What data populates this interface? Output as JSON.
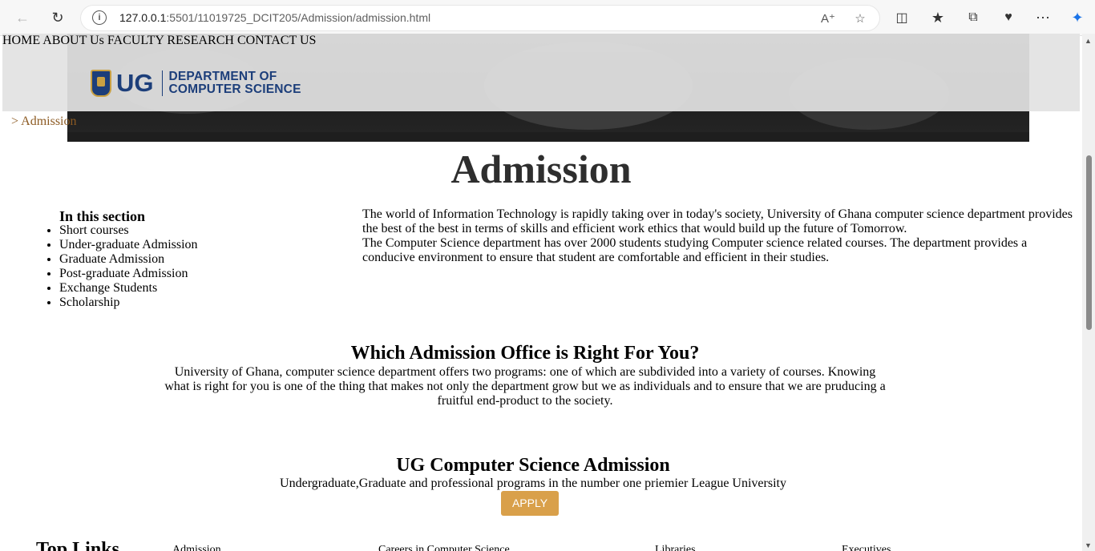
{
  "browser": {
    "url_host": "127.0.0.1",
    "url_rest": ":5501/11019725_DCIT205/Admission/admission.html"
  },
  "header": {
    "logo_ug": "UG",
    "logo_dept_line1": "DEPARTMENT OF",
    "logo_dept_line2": "COMPUTER SCIENCE",
    "nav": [
      "HOME",
      "ABOUT Us",
      "FACULTY",
      "RESEARCH",
      "CONTACT US"
    ]
  },
  "breadcrumb": "> Admission",
  "page_title": "Admission",
  "sidebar": {
    "heading": "In this section",
    "items": [
      "Short courses",
      "Under-graduate Admission",
      "Graduate Admission",
      "Post-graduate Admission",
      "Exchange Students",
      "Scholarship"
    ]
  },
  "intro": {
    "p1": "The world of Information Technology is rapidly taking over in today's society, University of Ghana computer science department provides the best of the best in terms of skills and efficient work ethics that would build up the future of Tomorrow.",
    "p2": "The Computer Science department has over 2000 students studying Computer science related courses. The department provides a conducive environment to ensure that student are comfortable and efficient in their studies."
  },
  "which": {
    "heading": "Which Admission Office is Right For You?",
    "text": "University of Ghana, computer science department offers two programs: one of which are subdivided into a variety of courses. Knowing what is right for you is one of the thing that makes not only the department grow but we as individuals and to ensure that we are pruducing a fruitful end-product to the society."
  },
  "ugcs": {
    "heading": "UG Computer Science Admission",
    "text": "Undergraduate,Graduate and professional programs in the number one priemier League University",
    "button": "APPLY"
  },
  "footer": {
    "heading": "Top Links",
    "links": [
      "Admission",
      "Careers in Computer Science",
      "Libraries",
      "Executives"
    ]
  }
}
